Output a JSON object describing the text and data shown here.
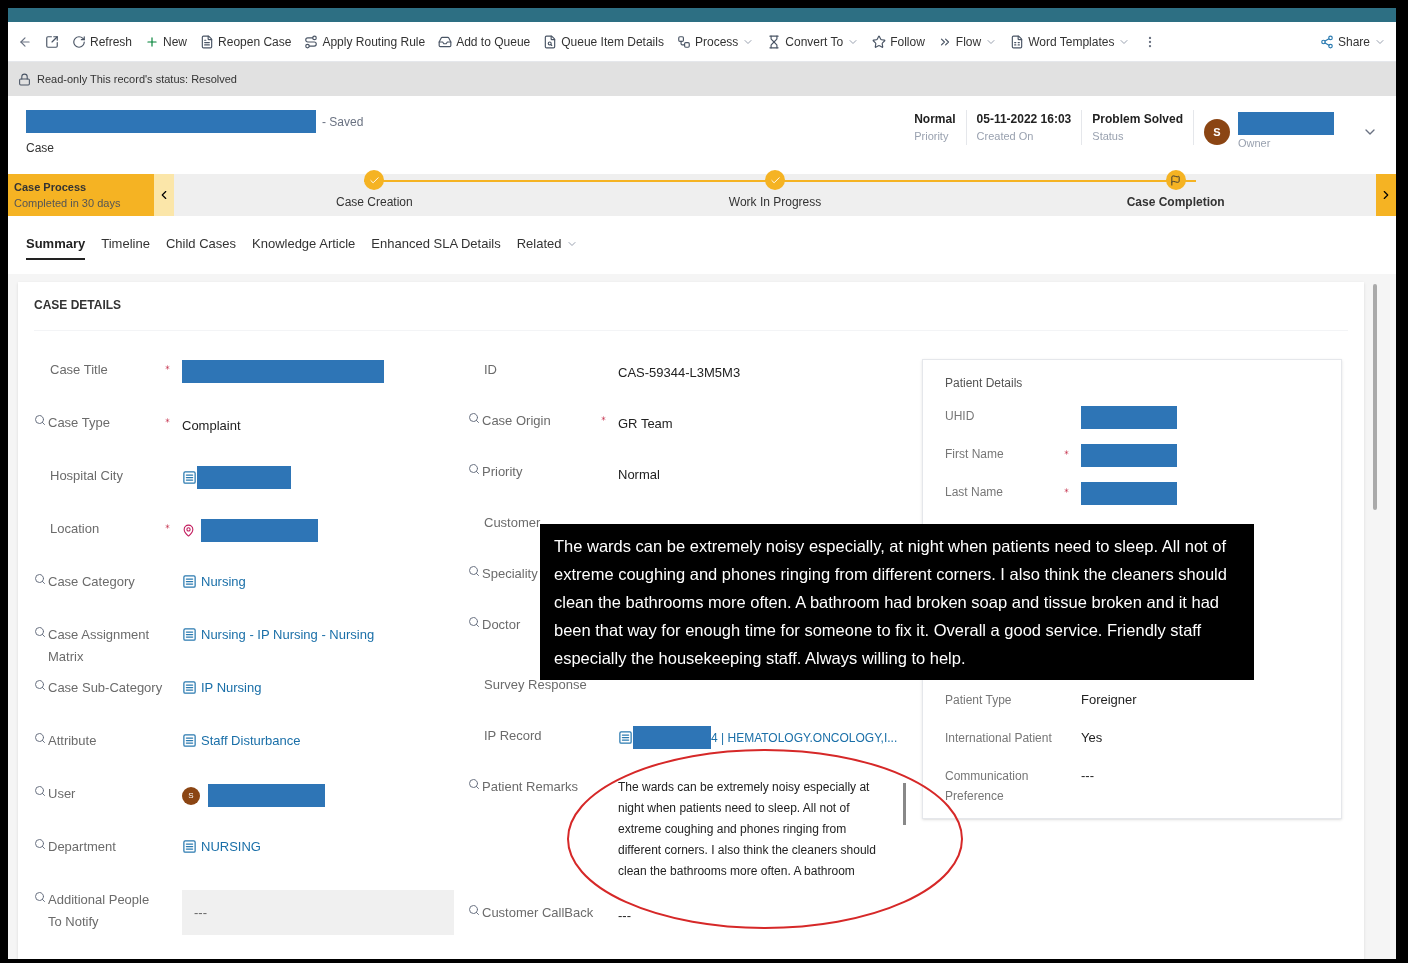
{
  "toolbar": [
    {
      "label": "Refresh",
      "has_menu": false
    },
    {
      "label": "New",
      "has_menu": false
    },
    {
      "label": "Reopen Case",
      "has_menu": false
    },
    {
      "label": "Apply Routing Rule",
      "has_menu": false
    },
    {
      "label": "Add to Queue",
      "has_menu": false
    },
    {
      "label": "Queue Item Details",
      "has_menu": false
    },
    {
      "label": "Process",
      "has_menu": true
    },
    {
      "label": "Convert To",
      "has_menu": true
    },
    {
      "label": "Follow",
      "has_menu": false
    },
    {
      "label": "Flow",
      "has_menu": true
    },
    {
      "label": "Word Templates",
      "has_menu": true
    }
  ],
  "share": {
    "label": "Share",
    "has_menu": true
  },
  "notice": "Read-only This record's status: Resolved",
  "header": {
    "saved": "- Saved",
    "entity": "Case",
    "fields": [
      {
        "value": "Normal",
        "label": "Priority"
      },
      {
        "value": "05-11-2022 16:03",
        "label": "Created On"
      },
      {
        "value": "Problem Solved",
        "label": "Status"
      }
    ],
    "owner": {
      "initial": "S",
      "label": "Owner"
    }
  },
  "process": {
    "title": "Case Process",
    "subtitle": "Completed in 30 days",
    "stages": [
      {
        "label": "Case Creation",
        "completed": true,
        "selected": false
      },
      {
        "label": "Work In Progress",
        "completed": true,
        "selected": false
      },
      {
        "label": "Case Completion",
        "completed": false,
        "selected": true
      }
    ]
  },
  "tabs": [
    {
      "label": "Summary",
      "selected": true
    },
    {
      "label": "Timeline",
      "selected": false
    },
    {
      "label": "Child Cases",
      "selected": false
    },
    {
      "label": "Knowledge Article",
      "selected": false
    },
    {
      "label": "Enhanced SLA Details",
      "selected": false
    },
    {
      "label": "Related",
      "selected": false,
      "has_menu": true
    }
  ],
  "section_title": "CASE DETAILS",
  "column_1": [
    {
      "label": "Case Title",
      "search": false,
      "required": true,
      "kind": "redacted"
    },
    {
      "label": "Case Type",
      "search": true,
      "required": true,
      "kind": "text",
      "value": "Complaint"
    },
    {
      "label": "Hospital City",
      "search": false,
      "required": false,
      "kind": "redacted_link"
    },
    {
      "label": "Location",
      "search": false,
      "required": true,
      "kind": "redacted_location"
    },
    {
      "label": "Case Category",
      "search": true,
      "required": false,
      "kind": "link",
      "value": "Nursing"
    },
    {
      "label": "Case Assignment Matrix",
      "search": true,
      "required": false,
      "kind": "link",
      "value": "Nursing - IP Nursing - Nursing"
    },
    {
      "label": "Case Sub-Category",
      "search": true,
      "required": false,
      "kind": "link",
      "value": "IP Nursing"
    },
    {
      "label": "Attribute",
      "search": true,
      "required": false,
      "kind": "link",
      "value": "Staff Disturbance"
    },
    {
      "label": "User",
      "search": true,
      "required": false,
      "kind": "redacted_user",
      "value": "S"
    },
    {
      "label": "Department",
      "search": true,
      "required": false,
      "kind": "link",
      "value": "NURSING"
    },
    {
      "label": "Additional People To Notify",
      "search": true,
      "required": false,
      "kind": "empty_field",
      "value": "---"
    }
  ],
  "column_2": [
    {
      "label": "ID",
      "search": false,
      "required": false,
      "kind": "text",
      "value": "CAS-59344-L3M5M3"
    },
    {
      "label": "Case Origin",
      "search": true,
      "required": true,
      "kind": "text",
      "value": "GR Team"
    },
    {
      "label": "Priority",
      "search": true,
      "required": false,
      "kind": "text",
      "value": "Normal"
    },
    {
      "label": "Customer",
      "search": false,
      "required": false,
      "kind": "hidden"
    },
    {
      "label": "Speciality",
      "search": true,
      "required": false,
      "kind": "hidden"
    },
    {
      "label": "Doctor",
      "search": true,
      "required": false,
      "kind": "hidden"
    },
    {
      "label": "Survey Response",
      "search": false,
      "required": false,
      "kind": "hidden"
    },
    {
      "label": "IP Record",
      "search": false,
      "required": false,
      "kind": "redacted_link",
      "value": "4 | HEMATOLOGY.ONCOLOGY,I..."
    },
    {
      "label": "Patient Remarks",
      "search": true,
      "required": false,
      "kind": "textarea",
      "value": "The wards can be extremely noisy especially at night when patients need to sleep. All not of extreme coughing and phones ringing from different corners. I also think the cleaners should clean the bathrooms more often. A bathroom"
    },
    {
      "label": "Customer CallBack",
      "search": true,
      "required": false,
      "kind": "text",
      "value": "---"
    }
  ],
  "patient_details": {
    "title": "Patient Details",
    "fields": [
      {
        "label": "UHID",
        "required": false,
        "kind": "redacted"
      },
      {
        "label": "First Name",
        "required": true,
        "kind": "redacted"
      },
      {
        "label": "Last Name",
        "required": true,
        "kind": "redacted"
      },
      {
        "label": "Patient Type",
        "required": false,
        "kind": "text",
        "value": "Foreigner"
      },
      {
        "label": "International Patient",
        "required": false,
        "kind": "text",
        "value": "Yes"
      },
      {
        "label": "Communication Preference",
        "required": false,
        "kind": "text",
        "value": "---"
      }
    ]
  },
  "callout": "The wards can be extremely noisy especially, at night when patients need to sleep. All not of extreme coughing and phones ringing from different corners. I also think the cleaners should clean the bathrooms more often. A bathroom had broken soap and tissue broken and it had been that way for enough time for someone to fix it. Overall a good service. Friendly staff especially the housekeeping staff. Always willing to help."
}
